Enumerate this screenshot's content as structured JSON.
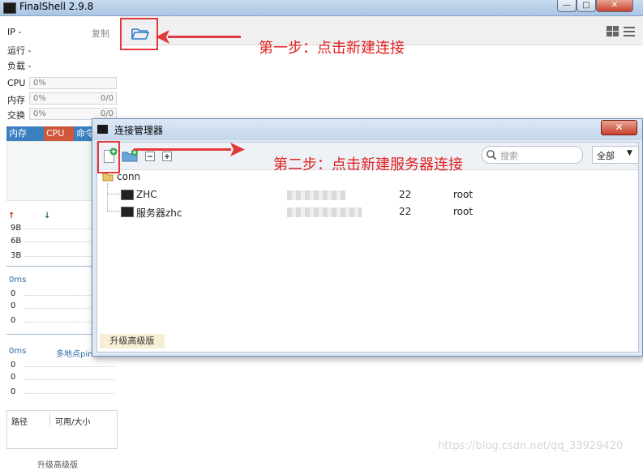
{
  "window": {
    "title": "FinalShell 2.9.8",
    "controls": [
      "—",
      "□",
      "✕"
    ]
  },
  "left_panel": {
    "ip_label": "IP",
    "ip_value": "-",
    "copy_label": "复制",
    "run_label": "运行",
    "run_value": "-",
    "load_label": "负载",
    "load_value": "-",
    "meters": [
      {
        "label": "CPU",
        "value": "0%",
        "extra": ""
      },
      {
        "label": "内存",
        "value": "0%",
        "extra": "0/0"
      },
      {
        "label": "交换",
        "value": "0%",
        "extra": "0/0"
      }
    ],
    "tabs": [
      {
        "label": "内存",
        "color": "#3a7fc0"
      },
      {
        "label": "CPU",
        "color": "#d0583a"
      },
      {
        "label": "命令",
        "color": "#3a7fc0"
      }
    ],
    "traffic_labels": [
      "9B",
      "6B",
      "3B"
    ],
    "latency1": {
      "header": "0ms",
      "values": [
        "0",
        "0",
        "0"
      ]
    },
    "latency2": {
      "header": "0ms",
      "link": "多地点ping",
      "values": [
        "0",
        "0",
        "0"
      ]
    },
    "disk_headers": [
      "路径",
      "可用/大小"
    ],
    "bottom_cut_text": "升级高级版"
  },
  "dialog": {
    "title": "连接管理器",
    "close_label": "✕",
    "search_placeholder": "搜索",
    "filter_selected": "全部",
    "upgrade_label": "升级高级版",
    "tree": {
      "folder": "conn",
      "items": [
        {
          "name": "ZHC",
          "port": "22",
          "user": "root"
        },
        {
          "name": "服务器zhc",
          "port": "22",
          "user": "root"
        }
      ]
    }
  },
  "annotations": {
    "step1": "第一步：点击新建连接",
    "step2": "第二步：点击新建服务器连接",
    "color": "#e23a3a"
  },
  "watermark": "https://blog.csdn.net/qq_33929420"
}
